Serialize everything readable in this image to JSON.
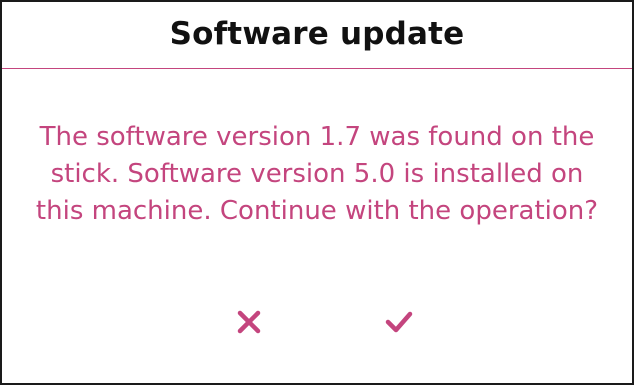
{
  "dialog": {
    "title": "Software update",
    "message": "The software version 1.7 was found on the stick. Software version 5.0 is installed on this machine. Continue with the operation?",
    "cancel_icon": "close-icon",
    "confirm_icon": "check-icon"
  },
  "colors": {
    "accent": "#c4457e",
    "title_text": "#111111",
    "border": "#1a1a1a",
    "background": "#ffffff"
  }
}
